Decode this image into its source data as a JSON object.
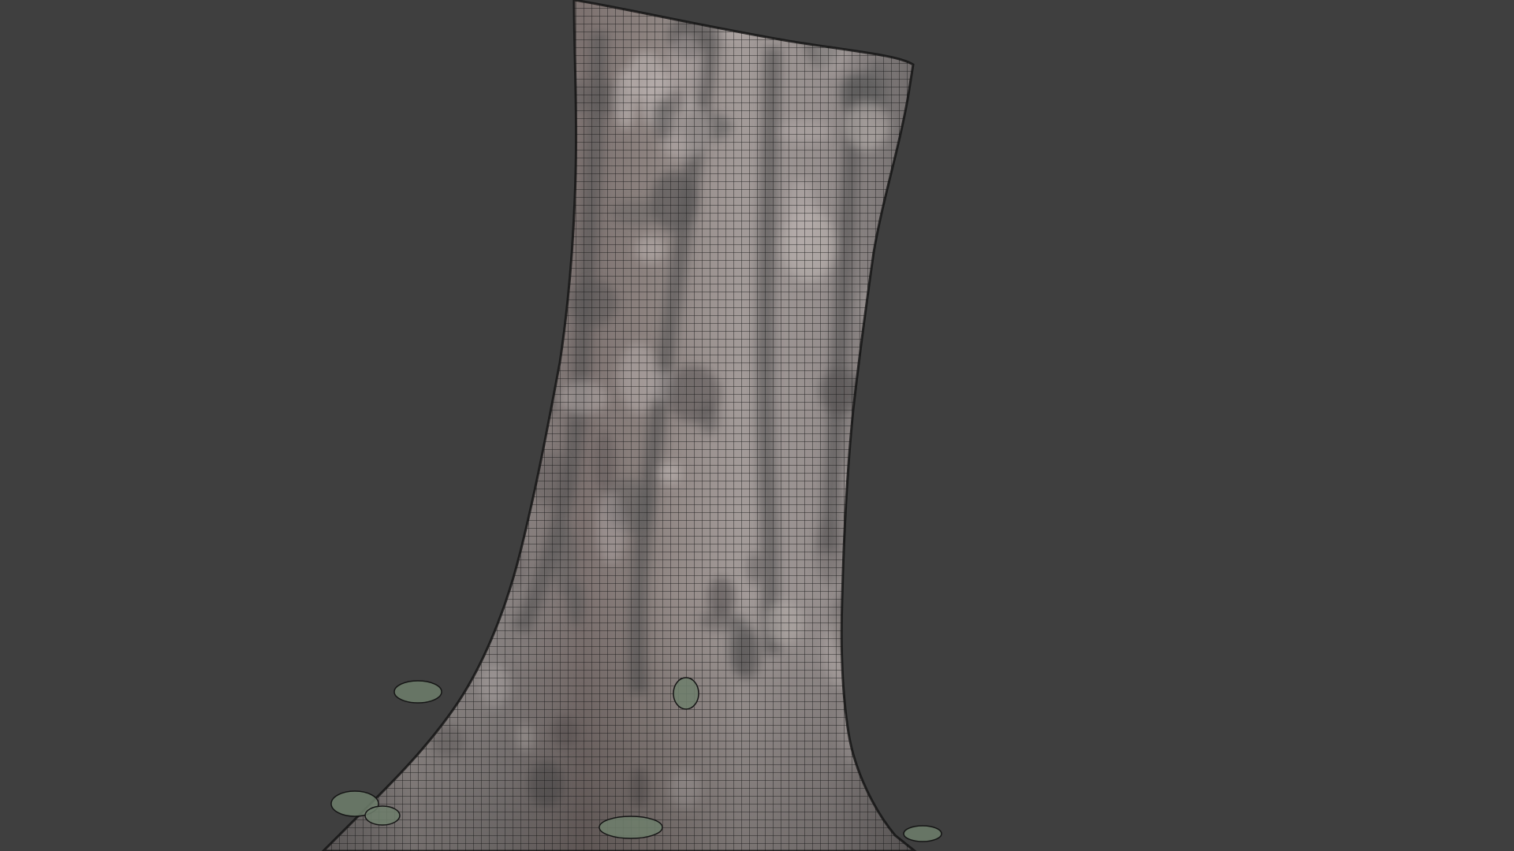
{
  "viewport": {
    "background_color": "#3f3f3f",
    "mode": "3d-viewport",
    "shading": "textured-with-wireframe-overlay"
  },
  "model": {
    "kind": "photoscanned-tree-trunk",
    "bark_color": "#8e8888",
    "bark_shadow_color": "#5b5858",
    "bark_highlight_color": "#b8b0ae",
    "wire_color": "#151515",
    "moss_color": "#6f7f6c"
  }
}
